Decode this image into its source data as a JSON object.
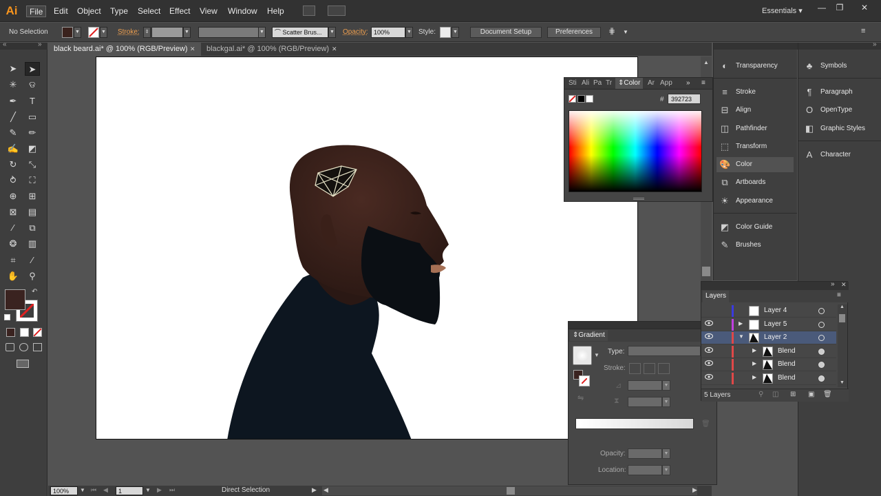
{
  "app": {
    "logo": "Ai"
  },
  "menu": [
    "File",
    "Edit",
    "Object",
    "Type",
    "Select",
    "Effect",
    "View",
    "Window",
    "Help"
  ],
  "workspace": {
    "label": "Essentials",
    "arrow": "▾"
  },
  "window_controls": {
    "minimize": "—",
    "restore": "❐",
    "close": "✕"
  },
  "control_bar": {
    "selection_label": "No Selection",
    "stroke_label": "Stroke:",
    "brush_label": "Scatter Brus...",
    "opacity_label": "Opacity:",
    "opacity_value": "100%",
    "style_label": "Style:",
    "document_setup": "Document Setup",
    "preferences": "Preferences",
    "fill_color": "#3a221d"
  },
  "tabs": [
    {
      "label": "black beard.ai* @ 100% (RGB/Preview)",
      "close": "✕"
    },
    {
      "label": "blackgal.ai* @ 100% (RGB/Preview)",
      "close": "✕"
    }
  ],
  "collapse": {
    "left": "«",
    "right": "»"
  },
  "toolbar": {
    "fill_color": "#3a2320"
  },
  "status_bar": {
    "zoom": "100%",
    "page": "1",
    "tool": "Direct Selection"
  },
  "color_panel": {
    "tabs": [
      "Sti",
      "Ali",
      "Pa",
      "Tr",
      "Color",
      "Ar",
      "App"
    ],
    "hex_label": "#",
    "hex_value": "392723"
  },
  "dock_left": [
    {
      "icon": "transparency-icon",
      "label": "Transparency"
    },
    {
      "icon": "stroke-icon",
      "label": "Stroke"
    },
    {
      "icon": "align-icon",
      "label": "Align"
    },
    {
      "icon": "pathfinder-icon",
      "label": "Pathfinder"
    },
    {
      "icon": "transform-icon",
      "label": "Transform"
    },
    {
      "icon": "color-icon",
      "label": "Color"
    },
    {
      "icon": "artboards-icon",
      "label": "Artboards"
    },
    {
      "icon": "appearance-icon",
      "label": "Appearance"
    },
    {
      "icon": "color-guide-icon",
      "label": "Color Guide"
    },
    {
      "icon": "brushes-icon",
      "label": "Brushes"
    }
  ],
  "dock_right": [
    {
      "icon": "symbols-icon",
      "label": "Symbols"
    },
    {
      "icon": "paragraph-icon",
      "label": "Paragraph"
    },
    {
      "icon": "opentype-icon",
      "label": "OpenType"
    },
    {
      "icon": "graphic-styles-icon",
      "label": "Graphic Styles"
    },
    {
      "icon": "character-icon",
      "label": "Character"
    }
  ],
  "layers": {
    "title": "Layers",
    "rows": [
      {
        "name": "Layer 4",
        "visible": false,
        "color": "#3a3ae0",
        "depth": 0,
        "expanded": null,
        "selected": false
      },
      {
        "name": "Layer 5",
        "visible": true,
        "color": "#c040e0",
        "depth": 0,
        "expanded": false,
        "selected": false
      },
      {
        "name": "Layer 2",
        "visible": true,
        "color": "#e04848",
        "depth": 0,
        "expanded": true,
        "selected": true
      },
      {
        "name": "Blend",
        "visible": true,
        "color": "#e04848",
        "depth": 1,
        "expanded": false,
        "selected": false
      },
      {
        "name": "Blend",
        "visible": true,
        "color": "#e04848",
        "depth": 1,
        "expanded": false,
        "selected": false
      },
      {
        "name": "Blend",
        "visible": true,
        "color": "#e04848",
        "depth": 1,
        "expanded": false,
        "selected": false
      }
    ],
    "count": "5 Layers"
  },
  "gradient": {
    "title": "Gradient",
    "type_label": "Type:",
    "stroke_label": "Stroke:",
    "opacity_label": "Opacity:",
    "location_label": "Location:"
  }
}
